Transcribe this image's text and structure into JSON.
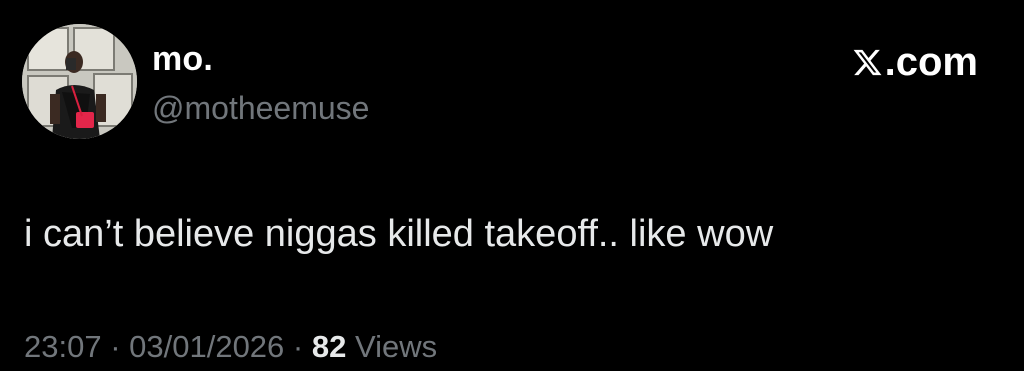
{
  "user": {
    "display_name": "mo.",
    "handle": "@motheemuse",
    "avatar_icon": "profile-photo"
  },
  "brand": {
    "logo_icon": "x-logo-icon",
    "label": ".com"
  },
  "tweet": {
    "text": "i can’t believe niggas killed takeoff.. like wow"
  },
  "meta": {
    "time": "23:07",
    "separator": " · ",
    "date": "03/01/2026",
    "views_count": "82",
    "views_label": " Views"
  },
  "colors": {
    "background": "#000000",
    "primary_text": "#e7e9ea",
    "secondary_text": "#71767b"
  }
}
